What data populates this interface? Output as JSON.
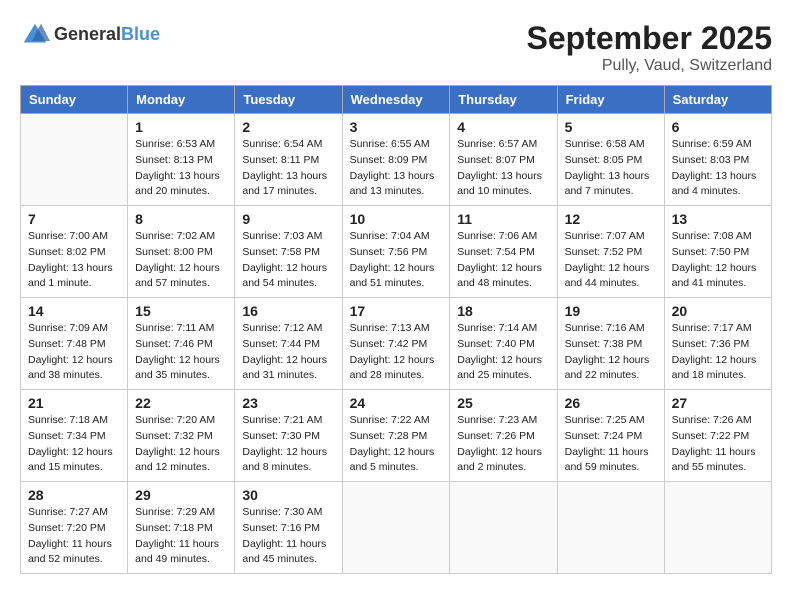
{
  "logo": {
    "general": "General",
    "blue": "Blue"
  },
  "header": {
    "month": "September 2025",
    "location": "Pully, Vaud, Switzerland"
  },
  "weekdays": [
    "Sunday",
    "Monday",
    "Tuesday",
    "Wednesday",
    "Thursday",
    "Friday",
    "Saturday"
  ],
  "weeks": [
    [
      {
        "day": "",
        "info": ""
      },
      {
        "day": "1",
        "info": "Sunrise: 6:53 AM\nSunset: 8:13 PM\nDaylight: 13 hours\nand 20 minutes."
      },
      {
        "day": "2",
        "info": "Sunrise: 6:54 AM\nSunset: 8:11 PM\nDaylight: 13 hours\nand 17 minutes."
      },
      {
        "day": "3",
        "info": "Sunrise: 6:55 AM\nSunset: 8:09 PM\nDaylight: 13 hours\nand 13 minutes."
      },
      {
        "day": "4",
        "info": "Sunrise: 6:57 AM\nSunset: 8:07 PM\nDaylight: 13 hours\nand 10 minutes."
      },
      {
        "day": "5",
        "info": "Sunrise: 6:58 AM\nSunset: 8:05 PM\nDaylight: 13 hours\nand 7 minutes."
      },
      {
        "day": "6",
        "info": "Sunrise: 6:59 AM\nSunset: 8:03 PM\nDaylight: 13 hours\nand 4 minutes."
      }
    ],
    [
      {
        "day": "7",
        "info": "Sunrise: 7:00 AM\nSunset: 8:02 PM\nDaylight: 13 hours\nand 1 minute."
      },
      {
        "day": "8",
        "info": "Sunrise: 7:02 AM\nSunset: 8:00 PM\nDaylight: 12 hours\nand 57 minutes."
      },
      {
        "day": "9",
        "info": "Sunrise: 7:03 AM\nSunset: 7:58 PM\nDaylight: 12 hours\nand 54 minutes."
      },
      {
        "day": "10",
        "info": "Sunrise: 7:04 AM\nSunset: 7:56 PM\nDaylight: 12 hours\nand 51 minutes."
      },
      {
        "day": "11",
        "info": "Sunrise: 7:06 AM\nSunset: 7:54 PM\nDaylight: 12 hours\nand 48 minutes."
      },
      {
        "day": "12",
        "info": "Sunrise: 7:07 AM\nSunset: 7:52 PM\nDaylight: 12 hours\nand 44 minutes."
      },
      {
        "day": "13",
        "info": "Sunrise: 7:08 AM\nSunset: 7:50 PM\nDaylight: 12 hours\nand 41 minutes."
      }
    ],
    [
      {
        "day": "14",
        "info": "Sunrise: 7:09 AM\nSunset: 7:48 PM\nDaylight: 12 hours\nand 38 minutes."
      },
      {
        "day": "15",
        "info": "Sunrise: 7:11 AM\nSunset: 7:46 PM\nDaylight: 12 hours\nand 35 minutes."
      },
      {
        "day": "16",
        "info": "Sunrise: 7:12 AM\nSunset: 7:44 PM\nDaylight: 12 hours\nand 31 minutes."
      },
      {
        "day": "17",
        "info": "Sunrise: 7:13 AM\nSunset: 7:42 PM\nDaylight: 12 hours\nand 28 minutes."
      },
      {
        "day": "18",
        "info": "Sunrise: 7:14 AM\nSunset: 7:40 PM\nDaylight: 12 hours\nand 25 minutes."
      },
      {
        "day": "19",
        "info": "Sunrise: 7:16 AM\nSunset: 7:38 PM\nDaylight: 12 hours\nand 22 minutes."
      },
      {
        "day": "20",
        "info": "Sunrise: 7:17 AM\nSunset: 7:36 PM\nDaylight: 12 hours\nand 18 minutes."
      }
    ],
    [
      {
        "day": "21",
        "info": "Sunrise: 7:18 AM\nSunset: 7:34 PM\nDaylight: 12 hours\nand 15 minutes."
      },
      {
        "day": "22",
        "info": "Sunrise: 7:20 AM\nSunset: 7:32 PM\nDaylight: 12 hours\nand 12 minutes."
      },
      {
        "day": "23",
        "info": "Sunrise: 7:21 AM\nSunset: 7:30 PM\nDaylight: 12 hours\nand 8 minutes."
      },
      {
        "day": "24",
        "info": "Sunrise: 7:22 AM\nSunset: 7:28 PM\nDaylight: 12 hours\nand 5 minutes."
      },
      {
        "day": "25",
        "info": "Sunrise: 7:23 AM\nSunset: 7:26 PM\nDaylight: 12 hours\nand 2 minutes."
      },
      {
        "day": "26",
        "info": "Sunrise: 7:25 AM\nSunset: 7:24 PM\nDaylight: 11 hours\nand 59 minutes."
      },
      {
        "day": "27",
        "info": "Sunrise: 7:26 AM\nSunset: 7:22 PM\nDaylight: 11 hours\nand 55 minutes."
      }
    ],
    [
      {
        "day": "28",
        "info": "Sunrise: 7:27 AM\nSunset: 7:20 PM\nDaylight: 11 hours\nand 52 minutes."
      },
      {
        "day": "29",
        "info": "Sunrise: 7:29 AM\nSunset: 7:18 PM\nDaylight: 11 hours\nand 49 minutes."
      },
      {
        "day": "30",
        "info": "Sunrise: 7:30 AM\nSunset: 7:16 PM\nDaylight: 11 hours\nand 45 minutes."
      },
      {
        "day": "",
        "info": ""
      },
      {
        "day": "",
        "info": ""
      },
      {
        "day": "",
        "info": ""
      },
      {
        "day": "",
        "info": ""
      }
    ]
  ]
}
